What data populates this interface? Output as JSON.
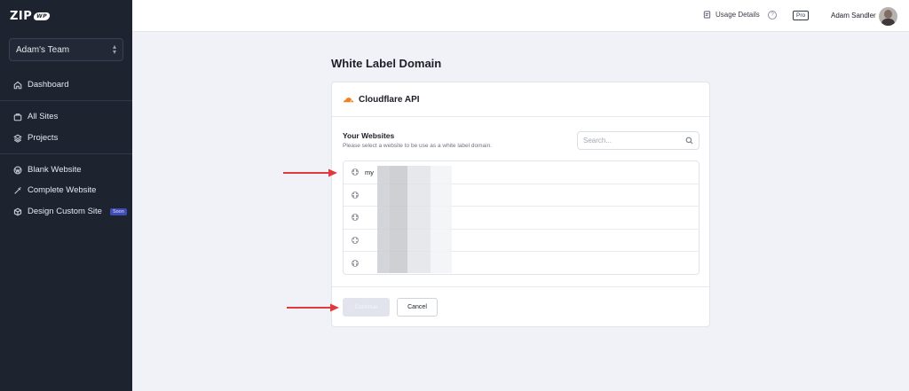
{
  "sidebar": {
    "logo": "ZIP",
    "logo_badge": "WP",
    "team": "Adam's Team",
    "items": [
      {
        "label": "Dashboard",
        "icon": "home-icon"
      },
      {
        "label": "All Sites",
        "icon": "briefcase-icon"
      },
      {
        "label": "Projects",
        "icon": "layers-icon"
      },
      {
        "label": "Blank Website",
        "icon": "wordpress-icon"
      },
      {
        "label": "Complete Website",
        "icon": "magic-wand-icon"
      },
      {
        "label": "Design Custom Site",
        "icon": "cube-icon",
        "badge": "Soon"
      }
    ]
  },
  "topbar": {
    "usage_label": "Usage Details",
    "plan_badge": "Pro",
    "user_name": "Adam Sandler",
    "help_label": "?"
  },
  "main": {
    "title": "White Label Domain",
    "card": {
      "provider": "Cloudflare API",
      "section_title": "Your Websites",
      "section_subtitle": "Please select a website to be use as a white label domain.",
      "search_placeholder": "Search...",
      "sites": [
        {
          "name": "my"
        },
        {
          "name": ""
        },
        {
          "name": ""
        },
        {
          "name": ""
        },
        {
          "name": ""
        }
      ],
      "continue_label": "Continue",
      "cancel_label": "Cancel"
    }
  },
  "colors": {
    "sidebar_bg": "#1e2330",
    "annotation_arrow": "#e0393e",
    "cloudflare_orange": "#f38020",
    "soon_badge": "#3f4cb5"
  }
}
